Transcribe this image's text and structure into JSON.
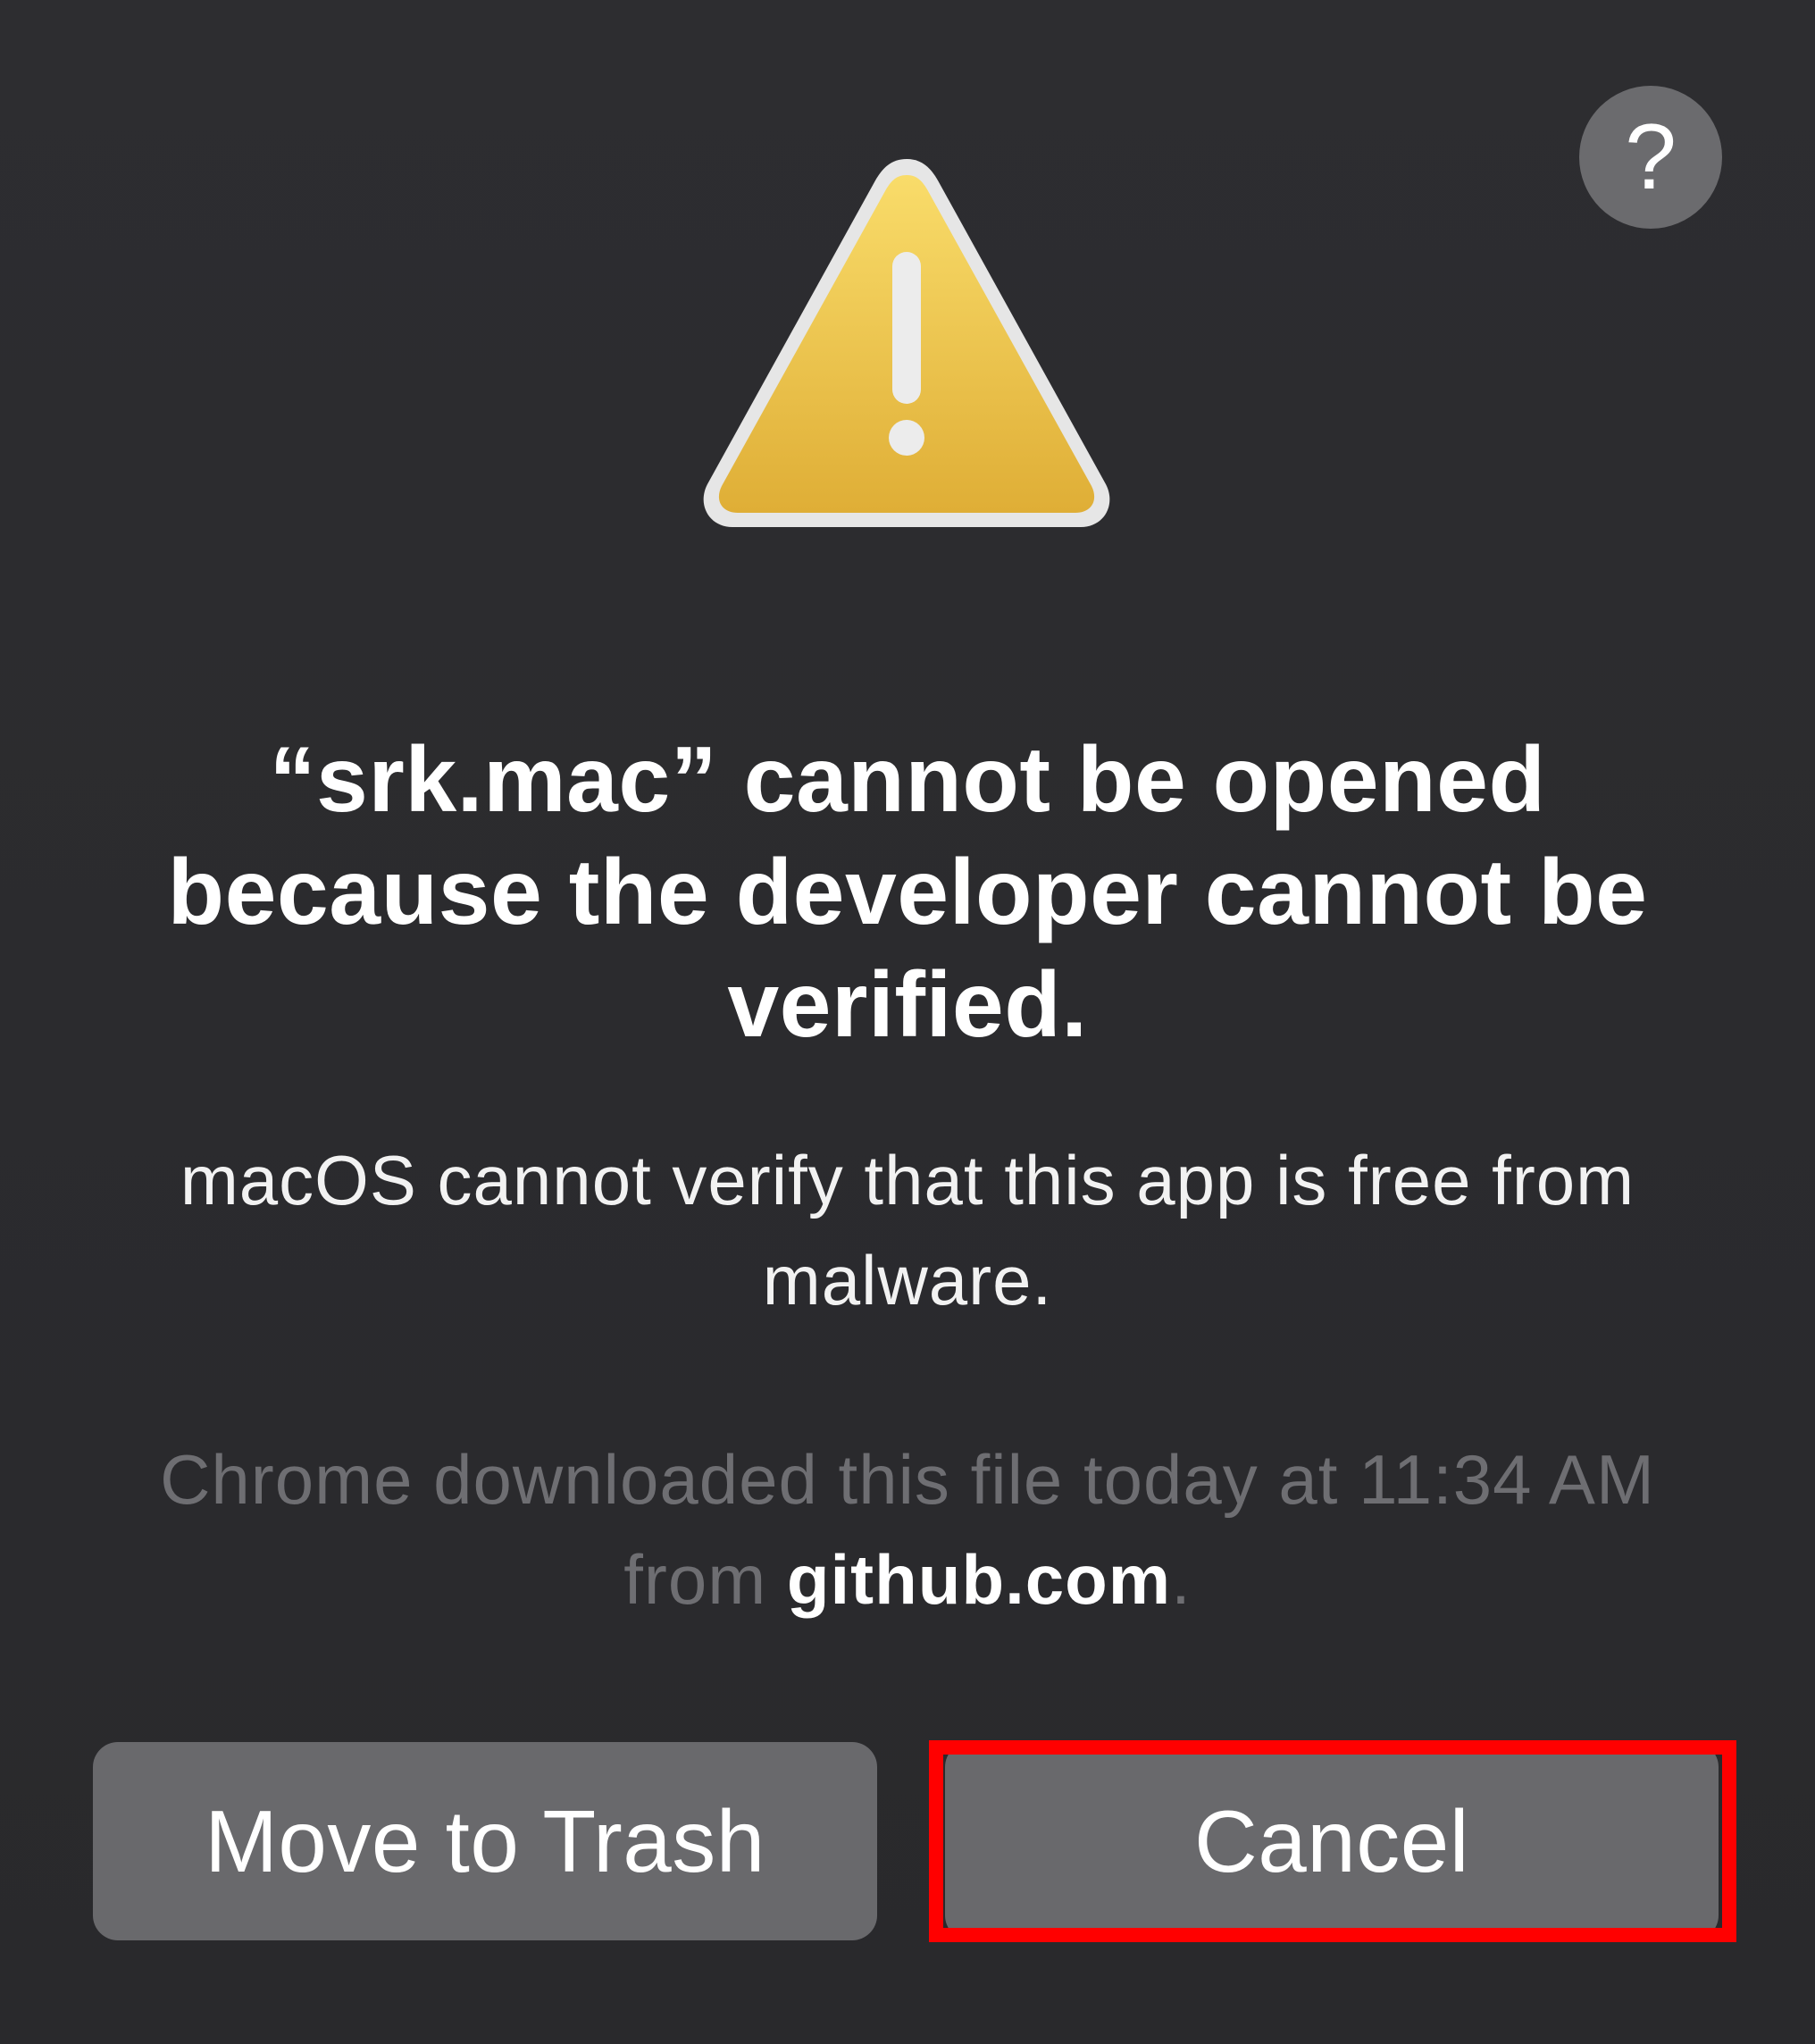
{
  "dialog": {
    "help_label": "?",
    "icon": "warning-triangle-icon",
    "title": "“srk.mac” cannot be opened because the developer cannot be verified.",
    "message": "macOS cannot verify that this app is free from malware.",
    "source_prefix": "Chrome downloaded this file today at 11:34 AM from ",
    "source_domain": "github.com",
    "source_suffix": ".",
    "buttons": {
      "move_to_trash": "Move to Trash",
      "cancel": "Cancel"
    }
  },
  "colors": {
    "background": "#2b2b2e",
    "button": "#69696c",
    "warning_yellow": "#f0c43c",
    "highlight": "#ff0000"
  }
}
